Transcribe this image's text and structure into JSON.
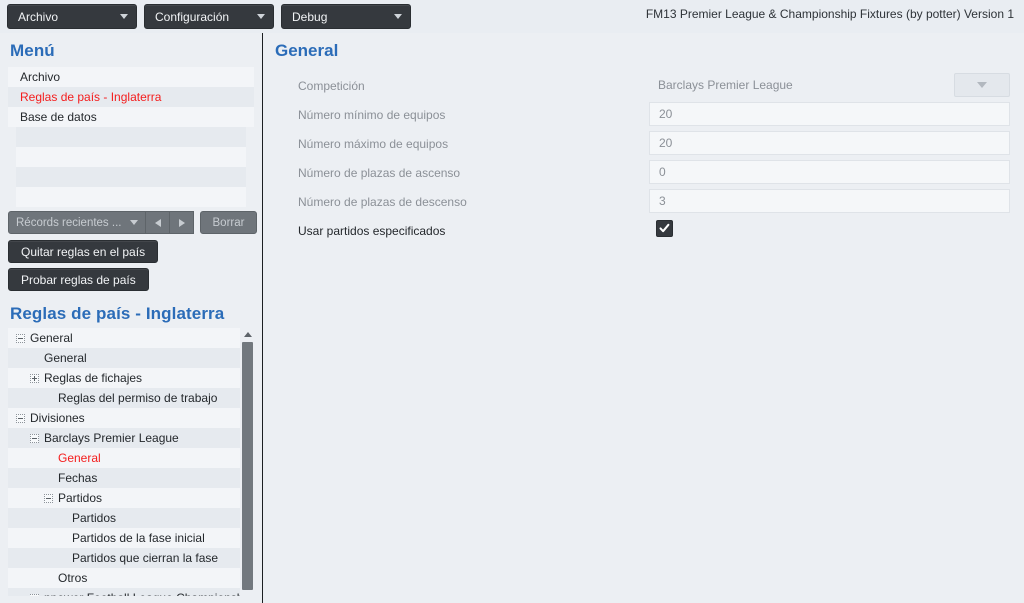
{
  "window": {
    "app_title": "FM13 Premier League & Championship Fixtures (by potter) Version 1"
  },
  "menubar": {
    "buttons": [
      {
        "label": "Archivo",
        "icon": "chevron-down-icon"
      },
      {
        "label": "Configuración",
        "icon": "chevron-down-icon"
      },
      {
        "label": "Debug",
        "icon": "chevron-down-icon"
      }
    ]
  },
  "sidebar": {
    "menu_title": "Menú",
    "menu_items": [
      {
        "label": "Archivo",
        "active": false
      },
      {
        "label": "Reglas de país - Inglaterra",
        "active": true
      },
      {
        "label": "Base de datos",
        "active": false
      }
    ],
    "recents": {
      "combo_value": "Récords recientes ...",
      "combo_caret_icon": "chevron-down-icon",
      "prev_icon": "triangle-left-icon",
      "next_icon": "triangle-right-icon",
      "clear_label": "Borrar"
    },
    "buttons": [
      {
        "label": "Quitar reglas en el país"
      },
      {
        "label": "Probar reglas de país"
      }
    ],
    "tree_title": "Reglas de país - Inglaterra",
    "tree": [
      {
        "label": "General",
        "depth": 0,
        "expander": "minus",
        "active": false
      },
      {
        "label": "General",
        "depth": 1,
        "expander": "none",
        "active": false
      },
      {
        "label": "Reglas de fichajes",
        "depth": 1,
        "expander": "plus",
        "active": false
      },
      {
        "label": "Reglas del permiso de trabajo",
        "depth": 2,
        "expander": "none",
        "active": false
      },
      {
        "label": "Divisiones",
        "depth": 0,
        "expander": "minus",
        "active": false
      },
      {
        "label": "Barclays Premier League",
        "depth": 1,
        "expander": "minus",
        "active": false
      },
      {
        "label": "General",
        "depth": 2,
        "expander": "none",
        "active": true
      },
      {
        "label": "Fechas",
        "depth": 2,
        "expander": "none",
        "active": false
      },
      {
        "label": "Partidos",
        "depth": 2,
        "expander": "minus",
        "active": false
      },
      {
        "label": "Partidos",
        "depth": 3,
        "expander": "none",
        "active": false
      },
      {
        "label": "Partidos de la fase inicial",
        "depth": 3,
        "expander": "none",
        "active": false
      },
      {
        "label": "Partidos que cierran la fase",
        "depth": 3,
        "expander": "none",
        "active": false
      },
      {
        "label": "Otros",
        "depth": 2,
        "expander": "none",
        "active": false
      },
      {
        "label": "npower Football League Championsh",
        "depth": 1,
        "expander": "plus",
        "active": false
      }
    ],
    "scrollbar": {
      "up_icon": "triangle-up-icon"
    }
  },
  "main": {
    "title": "General",
    "fields": [
      {
        "label": "Competición",
        "value": "Barclays Premier League",
        "type": "select",
        "disabled": true
      },
      {
        "label": "Número mínimo de equipos",
        "value": "20",
        "type": "text",
        "disabled": true
      },
      {
        "label": "Número máximo de equipos",
        "value": "20",
        "type": "text",
        "disabled": true
      },
      {
        "label": "Número de plazas de ascenso",
        "value": "0",
        "type": "text",
        "disabled": true
      },
      {
        "label": "Número de plazas de descenso",
        "value": "3",
        "type": "text",
        "disabled": true
      },
      {
        "label": "Usar partidos especificados",
        "value": "checked",
        "type": "checkbox",
        "disabled": false
      }
    ],
    "dropdown_icon": "chevron-down-icon",
    "check_icon": "check-icon"
  },
  "colors": {
    "accent_blue": "#2b6cb8",
    "active_red": "#f41d1d",
    "dark_button": "#35393e",
    "panel_bg": "#eceff3",
    "row_alt": "#e6eaef"
  }
}
